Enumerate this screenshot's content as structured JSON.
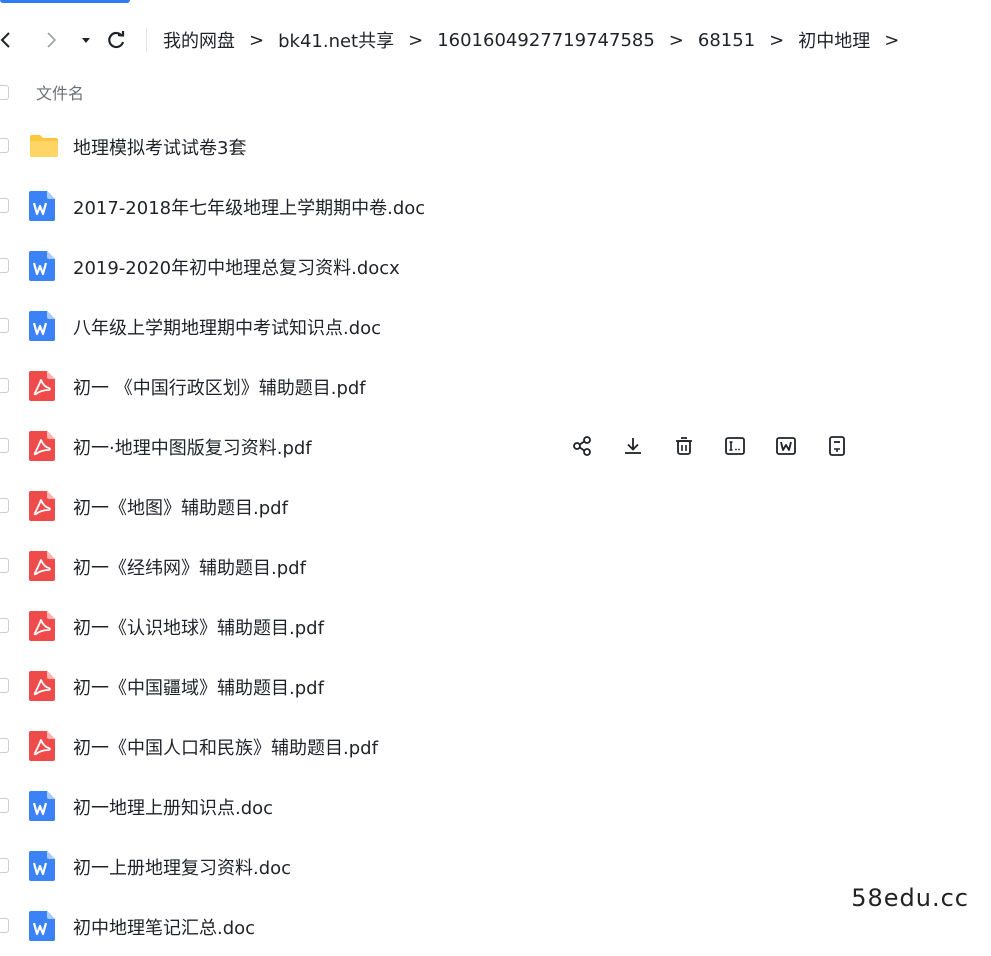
{
  "breadcrumb": {
    "items": [
      "我的网盘",
      "bk41.net共享",
      "1601604927719747585",
      "68151",
      "初中地理"
    ],
    "separator": ">"
  },
  "header": {
    "column_name": "文件名"
  },
  "files": [
    {
      "name": "地理模拟考试试卷3套",
      "type": "folder"
    },
    {
      "name": "2017-2018年七年级地理上学期期中卷.doc",
      "type": "word"
    },
    {
      "name": "2019-2020年初中地理总复习资料.docx",
      "type": "word"
    },
    {
      "name": "八年级上学期地理期中考试知识点.doc",
      "type": "word"
    },
    {
      "name": "初一 《中国行政区划》辅助题目.pdf",
      "type": "pdf"
    },
    {
      "name": "初一·地理中图版复习资料.pdf",
      "type": "pdf"
    },
    {
      "name": "初一《地图》辅助题目.pdf",
      "type": "pdf"
    },
    {
      "name": "初一《经纬网》辅助题目.pdf",
      "type": "pdf"
    },
    {
      "name": "初一《认识地球》辅助题目.pdf",
      "type": "pdf"
    },
    {
      "name": "初一《中国疆域》辅助题目.pdf",
      "type": "pdf"
    },
    {
      "name": "初一《中国人口和民族》辅助题目.pdf",
      "type": "pdf"
    },
    {
      "name": "初一地理上册知识点.doc",
      "type": "word"
    },
    {
      "name": "初一上册地理复习资料.doc",
      "type": "word"
    },
    {
      "name": "初中地理笔记汇总.doc",
      "type": "word"
    }
  ],
  "hover_row_index": 5,
  "row_action_icons": [
    "share-icon",
    "download-icon",
    "delete-icon",
    "rename-icon",
    "word-convert-icon",
    "more-doc-icon"
  ],
  "colors": {
    "accent": "#2f7cf6",
    "folder": "#ffc53d",
    "word": "#3b82f6",
    "pdf": "#ef4b4b"
  },
  "watermark": "58edu.cc"
}
